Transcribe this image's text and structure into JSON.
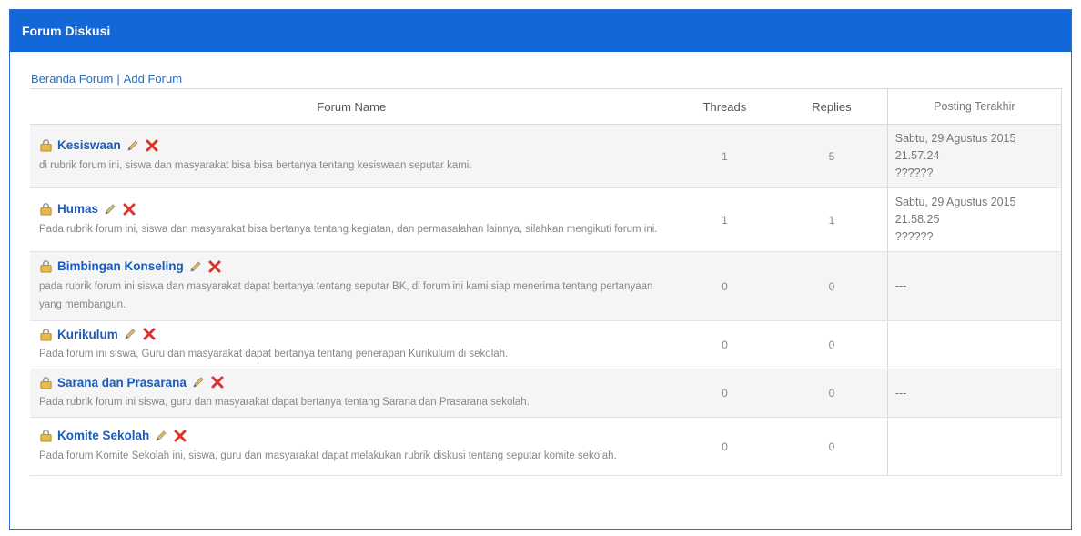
{
  "header": {
    "title": "Forum Diskusi"
  },
  "breadcrumb": {
    "home": "Beranda Forum",
    "separator": "|",
    "add": "Add Forum"
  },
  "table": {
    "headers": {
      "name": "Forum Name",
      "threads": "Threads",
      "replies": "Replies",
      "last": "Posting Terakhir"
    },
    "rows": [
      {
        "title": "Kesiswaan",
        "desc": "di rubrik forum ini, siswa dan masyarakat bisa bisa bertanya tentang kesiswaan seputar kami.",
        "threads": "1",
        "replies": "5",
        "last1": "Sabtu, 29 Agustus 2015",
        "last2": "21.57.24",
        "last3": "??????"
      },
      {
        "title": "Humas",
        "desc": "Pada rubrik forum ini, siswa dan masyarakat bisa bertanya tentang kegiatan, dan permasalahan lainnya, silahkan mengikuti forum ini.",
        "threads": "1",
        "replies": "1",
        "last1": "Sabtu, 29 Agustus 2015",
        "last2": "21.58.25",
        "last3": "??????"
      },
      {
        "title": "Bimbingan Konseling",
        "desc": "pada rubrik forum ini siswa dan masyarakat dapat bertanya tentang seputar BK, di forum ini kami siap menerima tentang pertanyaan yang membangun.",
        "threads": "0",
        "replies": "0",
        "last1": "---",
        "last2": "",
        "last3": ""
      },
      {
        "title": "Kurikulum",
        "desc": "Pada forum ini siswa, Guru dan masyarakat dapat bertanya tentang penerapan Kurikulum di sekolah.",
        "threads": "0",
        "replies": "0",
        "last1": "",
        "last2": "",
        "last3": ""
      },
      {
        "title": "Sarana dan Prasarana",
        "desc": "Pada rubrik forum ini siswa, guru dan masyarakat dapat bertanya tentang Sarana dan Prasarana sekolah.",
        "threads": "0",
        "replies": "0",
        "last1": "---",
        "last2": "",
        "last3": ""
      },
      {
        "title": "Komite Sekolah",
        "desc": "Pada forum Komite Sekolah ini, siswa, guru dan masyarakat dapat melakukan rubrik diskusi tentang seputar komite sekolah.",
        "threads": "0",
        "replies": "0",
        "last1": "",
        "last2": "",
        "last3": ""
      }
    ]
  }
}
